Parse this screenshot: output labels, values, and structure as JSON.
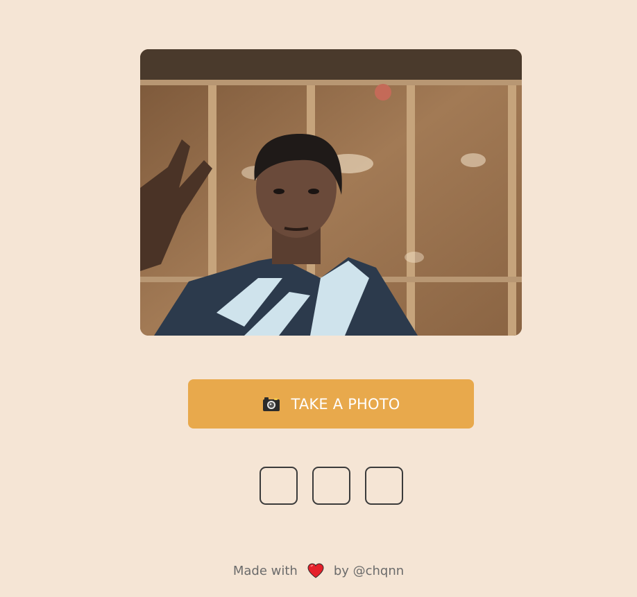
{
  "camera": {
    "label": "live camera preview"
  },
  "capture": {
    "label": "TAKE A PHOTO",
    "icon": "camera-icon",
    "background": "#e8a94c"
  },
  "thumbnails": {
    "count": 3,
    "filled": 0
  },
  "footer": {
    "prefix": "Made with",
    "icon": "heart-icon",
    "suffix": "by @chqnn"
  },
  "colors": {
    "page_background": "#f5e5d5",
    "button": "#e8a94c",
    "button_text": "#ffffff",
    "slot_border": "#3a3a3a",
    "footer_text": "#6b6b6b",
    "heart": "#e5202a"
  }
}
